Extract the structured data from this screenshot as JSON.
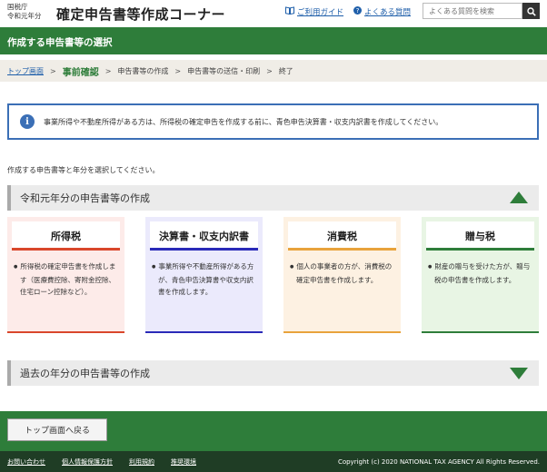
{
  "header": {
    "agency_line1": "国税庁",
    "agency_line2": "令和元年分",
    "app_title": "確定申告書等作成コーナー",
    "guide_link": "ご利用ガイド",
    "faq_link": "よくある質問",
    "search_placeholder": "よくある質問を検索"
  },
  "title_bar": "作成する申告書等の選択",
  "breadcrumb": {
    "items": [
      "トップ画面",
      "事前確認",
      "申告書等の作成",
      "申告書等の送信・印刷",
      "終了"
    ],
    "current_index": 1
  },
  "info": "事業所得や不動産所得がある方は、所得税の確定申告を作成する前に、青色申告決算書・収支内訳書を作成してください。",
  "instruction": "作成する申告書等と年分を選択してください。",
  "section_current": "令和元年分の申告書等の作成",
  "section_past": "過去の年分の申告書等の作成",
  "cards": [
    {
      "title": "所得税",
      "desc": "所得税の確定申告書を作成します（医療費控除、寄附金控除、住宅ローン控除など）。",
      "bg": "#fdebe9",
      "accent": "#d9472b"
    },
    {
      "title": "決算書・収支内訳書",
      "desc": "事業所得や不動産所得がある方が、青色申告決算書や収支内訳書を作成します。",
      "bg": "#ebeafc",
      "accent": "#2a2ab8"
    },
    {
      "title": "消費税",
      "desc": "個人の事業者の方が、消費税の確定申告書を作成します。",
      "bg": "#fdf1e2",
      "accent": "#e8a33c"
    },
    {
      "title": "贈与税",
      "desc": "財産の贈与を受けた方が、贈与税の申告書を作成します。",
      "bg": "#e8f5e4",
      "accent": "#2e7d3a"
    }
  ],
  "back_button": "トップ画面へ戻る",
  "footer": {
    "links": [
      "お問い合わせ",
      "個人情報保護方針",
      "利用規約",
      "推奨環境"
    ],
    "copyright": "Copyright (c) 2020 NATIONAL TAX AGENCY All Rights Reserved."
  },
  "colors": {
    "brand_green": "#2e7d3a",
    "link_blue": "#1f5faa"
  }
}
